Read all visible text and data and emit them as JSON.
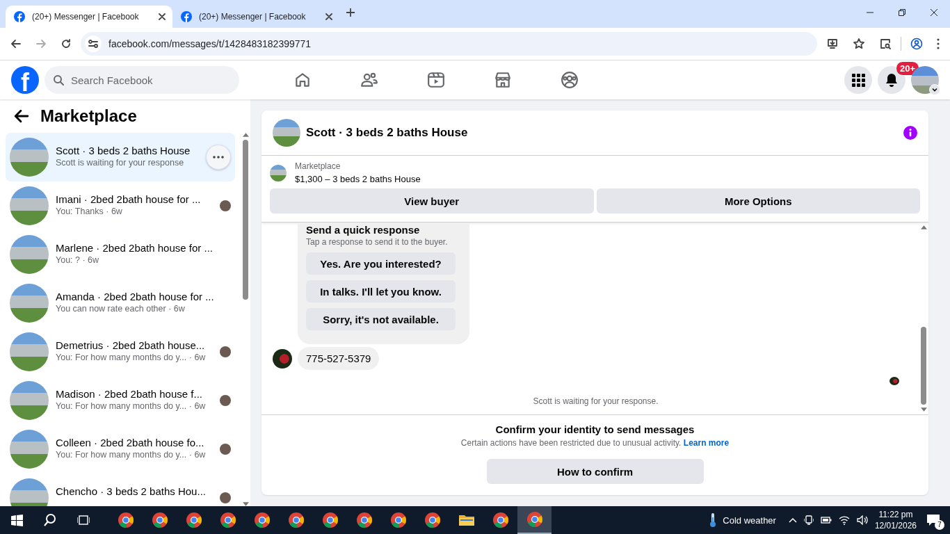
{
  "browser": {
    "tabs": [
      {
        "title": "(20+) Messenger | Facebook",
        "selected": true
      },
      {
        "title": "(20+) Messenger | Facebook",
        "selected": false
      }
    ],
    "url": "facebook.com/messages/t/1428483182399771"
  },
  "header": {
    "logo": "f",
    "search": {
      "placeholder": "Search Facebook"
    },
    "notification_badge": "20+"
  },
  "sidebar": {
    "title": "Marketplace",
    "conversations": [
      {
        "title": "Scott · 3 beds 2 baths House",
        "preview": "Scott is waiting for your response",
        "selected": true,
        "seen": false
      },
      {
        "title": "Imani · 2bed 2bath house for ...",
        "preview": "You: Thanks · 6w",
        "selected": false,
        "seen": true
      },
      {
        "title": "Marlene · 2bed 2bath house for ...",
        "preview": "You: ? · 6w",
        "selected": false,
        "seen": false
      },
      {
        "title": "Amanda · 2bed 2bath house for ...",
        "preview": "You can now rate each other · 6w",
        "selected": false,
        "seen": false
      },
      {
        "title": "Demetrius · 2bed 2bath house...",
        "preview": "You: For how many months do y... · 6w",
        "selected": false,
        "seen": true
      },
      {
        "title": "Madison · 2bed 2bath house f...",
        "preview": "You: For how many months do y... · 6w",
        "selected": false,
        "seen": true
      },
      {
        "title": "Colleen · 2bed 2bath house fo...",
        "preview": "You: For how many months do y... · 6w",
        "selected": false,
        "seen": true
      },
      {
        "title": "Chencho · 3 beds 2 baths Hou...",
        "selected": false,
        "seen": true
      }
    ]
  },
  "chat": {
    "title": "Scott · 3 beds 2 baths House",
    "listing": {
      "label": "Marketplace",
      "description": "$1,300 – 3 beds 2 baths House",
      "buttons": [
        "View buyer",
        "More Options"
      ]
    },
    "quick_response": {
      "title": "Send a quick response",
      "subtitle": "Tap a response to send it to the buyer.",
      "options": [
        "Yes. Are you interested?",
        "In talks. I'll let you know.",
        "Sorry, it's not available."
      ]
    },
    "messages": [
      {
        "text": "775-527-5379"
      }
    ],
    "status": "Scott is waiting for your response.",
    "restriction": {
      "title": "Confirm your identity to send messages",
      "text": "Certain actions have been restricted due to unusual activity.",
      "link": "Learn more",
      "button": "How to confirm"
    }
  },
  "taskbar": {
    "apps": [
      {
        "kind": "chrome",
        "selected": false
      },
      {
        "kind": "chrome",
        "selected": false
      },
      {
        "kind": "chrome",
        "selected": false
      },
      {
        "kind": "chrome",
        "selected": false
      },
      {
        "kind": "chrome",
        "selected": false
      },
      {
        "kind": "chrome",
        "selected": false
      },
      {
        "kind": "chrome",
        "selected": false
      },
      {
        "kind": "chrome",
        "selected": false
      },
      {
        "kind": "chrome",
        "selected": false
      },
      {
        "kind": "chrome",
        "selected": false
      },
      {
        "kind": "folder",
        "selected": false
      },
      {
        "kind": "chrome",
        "selected": false
      },
      {
        "kind": "chrome",
        "selected": true
      }
    ],
    "weather": "Cold weather",
    "time": "11:22 pm",
    "date": "12/01/2026",
    "notification_count": "7"
  }
}
